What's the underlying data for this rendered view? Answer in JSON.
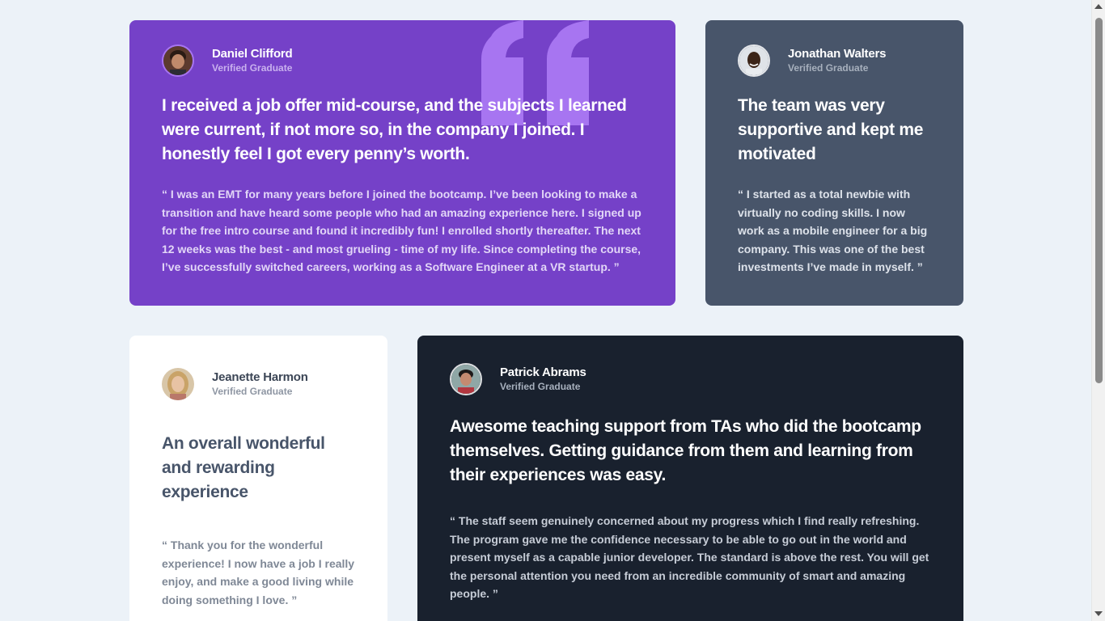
{
  "colors": {
    "page_bg": "#ecf2f8",
    "purple": "#7541c8",
    "gray_blue": "#48556a",
    "white": "#ffffff",
    "dark_navy": "#19212e",
    "quote_mark": "#a775f1"
  },
  "testimonials": [
    {
      "name": "Daniel Clifford",
      "badge": "Verified Graduate",
      "headline": "I received a job offer mid-course, and the subjects I learned were current, if not more so, in the company I joined. I honestly feel I got every penny’s worth.",
      "body": "“ I was an EMT for many years before I joined the bootcamp. I’ve been looking to make a transition and have heard some people who had an amazing experience here. I signed up for the free intro course and found it incredibly fun! I enrolled shortly thereafter. The next 12 weeks was the best - and most grueling - time of my life. Since completing the course, I’ve successfully switched careers, working as a Software Engineer at a VR startup. ”",
      "avatar_icon": "avatar-daniel-icon"
    },
    {
      "name": "Jonathan Walters",
      "badge": "Verified Graduate",
      "headline": "The team was very supportive and kept me motivated",
      "body": "“ I started as a total newbie with virtually no coding skills. I now work as a mobile engineer for a big company. This was one of the best investments I’ve made in myself. ”",
      "avatar_icon": "avatar-jonathan-icon"
    },
    {
      "name": "Jeanette Harmon",
      "badge": "Verified Graduate",
      "headline": "An overall wonderful and rewarding experience",
      "body": "“ Thank you for the wonderful experience! I now have a job I really enjoy, and make a good living while doing something I love. ”",
      "avatar_icon": "avatar-jeanette-icon"
    },
    {
      "name": "Patrick Abrams",
      "badge": "Verified Graduate",
      "headline": "Awesome teaching support from TAs who did the bootcamp themselves. Getting guidance from them and learning from their experiences was easy.",
      "body": "“ The staff seem genuinely concerned about my progress which I find really refreshing. The program gave me the confidence necessary to be able to go out in the world and present myself as a capable junior developer. The standard is above the rest. You will get the personal attention you need from an incredible community of smart and amazing people. ”",
      "avatar_icon": "avatar-patrick-icon"
    }
  ],
  "decor": {
    "quote_icon": "quotation-mark-icon"
  }
}
